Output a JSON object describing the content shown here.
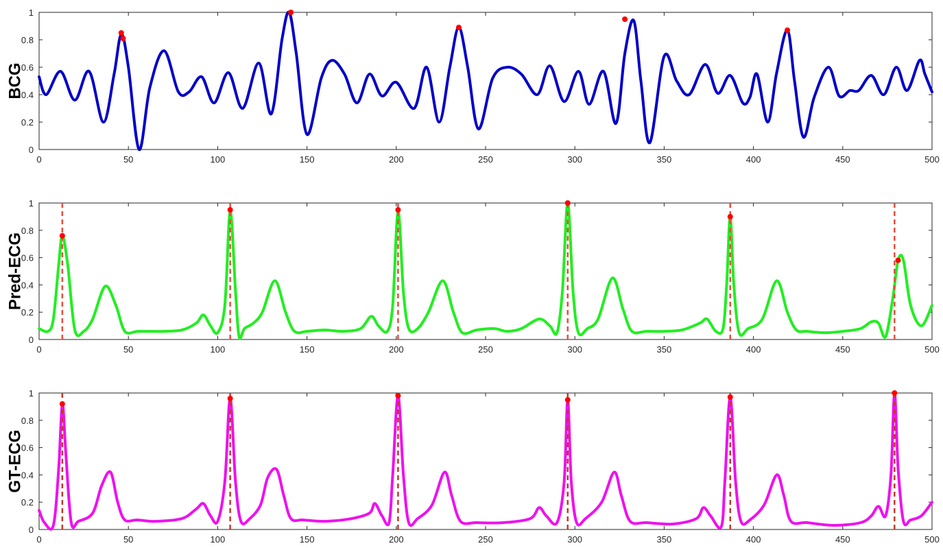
{
  "chart_data": [
    {
      "type": "line",
      "ylabel": "BCG",
      "xlim": [
        0,
        500
      ],
      "ylim": [
        0,
        1
      ],
      "xticks": [
        0,
        50,
        100,
        150,
        200,
        250,
        300,
        350,
        400,
        450,
        500
      ],
      "yticks": [
        0,
        0.2,
        0.4,
        0.6,
        0.8,
        1
      ],
      "xtick_labels": [
        "0",
        "50",
        "100",
        "150",
        "200",
        "250",
        "300",
        "350",
        "400",
        "450",
        "500"
      ],
      "ytick_labels": [
        "0",
        "0.2",
        "0.4",
        "0.6",
        "0.8",
        "1"
      ],
      "grid": false,
      "series": [
        {
          "color": "#0000c8",
          "x": [
            0,
            4,
            12,
            20,
            28,
            36,
            42,
            46,
            50,
            56,
            62,
            70,
            78,
            84,
            91,
            98,
            106,
            114,
            123,
            130,
            136,
            140,
            144,
            150,
            158,
            164,
            171,
            178,
            185,
            192,
            200,
            210,
            217,
            224,
            230,
            235,
            240,
            246,
            254,
            262,
            270,
            279,
            286,
            294,
            302,
            308,
            316,
            323,
            328,
            333,
            337,
            342,
            350,
            357,
            364,
            373,
            380,
            387,
            394,
            398,
            402,
            408,
            413,
            419,
            423,
            428,
            434,
            442,
            448,
            454,
            459,
            466,
            473,
            480,
            486,
            493,
            496,
            500
          ],
          "values": [
            0.53,
            0.4,
            0.57,
            0.36,
            0.57,
            0.2,
            0.55,
            0.84,
            0.6,
            0.0,
            0.45,
            0.72,
            0.42,
            0.42,
            0.53,
            0.34,
            0.56,
            0.3,
            0.63,
            0.26,
            0.8,
            1.0,
            0.7,
            0.11,
            0.52,
            0.65,
            0.55,
            0.34,
            0.55,
            0.39,
            0.49,
            0.3,
            0.6,
            0.2,
            0.6,
            0.89,
            0.6,
            0.15,
            0.52,
            0.6,
            0.55,
            0.4,
            0.61,
            0.35,
            0.57,
            0.33,
            0.57,
            0.19,
            0.7,
            0.94,
            0.5,
            0.05,
            0.68,
            0.5,
            0.4,
            0.62,
            0.41,
            0.54,
            0.34,
            0.38,
            0.55,
            0.2,
            0.56,
            0.87,
            0.5,
            0.09,
            0.38,
            0.6,
            0.39,
            0.43,
            0.43,
            0.54,
            0.4,
            0.6,
            0.43,
            0.65,
            0.55,
            0.42
          ]
        }
      ],
      "peaks": {
        "color": "#ff0000",
        "x": [
          46,
          47,
          141,
          235,
          328,
          419
        ],
        "values": [
          0.85,
          0.81,
          1.0,
          0.89,
          0.95,
          0.87
        ]
      },
      "vlines": []
    },
    {
      "type": "line",
      "ylabel": "Pred-ECG",
      "xlim": [
        0,
        500
      ],
      "ylim": [
        0,
        1
      ],
      "xticks": [
        0,
        50,
        100,
        150,
        200,
        250,
        300,
        350,
        400,
        450,
        500
      ],
      "yticks": [
        0,
        0.2,
        0.4,
        0.6,
        0.8,
        1
      ],
      "xtick_labels": [
        "0",
        "50",
        "100",
        "150",
        "200",
        "250",
        "300",
        "350",
        "400",
        "450",
        "500"
      ],
      "ytick_labels": [
        "0",
        "0.2",
        "0.4",
        "0.6",
        "0.8",
        "1"
      ],
      "grid": false,
      "series": [
        {
          "color": "#22ee22",
          "x": [
            0,
            5,
            8,
            11,
            13,
            16,
            20,
            25,
            30,
            37,
            43,
            48,
            55,
            62,
            70,
            80,
            88,
            92,
            96,
            100,
            104,
            107,
            110,
            112,
            115,
            120,
            125,
            132,
            138,
            143,
            150,
            160,
            170,
            180,
            186,
            190,
            195,
            198,
            201,
            204,
            207,
            212,
            218,
            226,
            232,
            237,
            245,
            255,
            262,
            270,
            280,
            286,
            290,
            293,
            296,
            299,
            302,
            307,
            313,
            321,
            327,
            332,
            340,
            350,
            360,
            370,
            374,
            379,
            383,
            385,
            387,
            389,
            392,
            397,
            405,
            413,
            419,
            424,
            430,
            440,
            450,
            460,
            466,
            470,
            474,
            478,
            481,
            484,
            488,
            494,
            500
          ],
          "values": [
            0.08,
            0.06,
            0.15,
            0.55,
            0.76,
            0.55,
            0.07,
            0.06,
            0.15,
            0.39,
            0.25,
            0.06,
            0.06,
            0.06,
            0.06,
            0.07,
            0.12,
            0.18,
            0.1,
            0.05,
            0.25,
            0.94,
            0.35,
            0.02,
            0.08,
            0.12,
            0.2,
            0.43,
            0.2,
            0.06,
            0.06,
            0.07,
            0.06,
            0.08,
            0.17,
            0.1,
            0.06,
            0.25,
            0.94,
            0.35,
            0.08,
            0.08,
            0.2,
            0.43,
            0.2,
            0.05,
            0.07,
            0.08,
            0.06,
            0.08,
            0.15,
            0.1,
            0.05,
            0.35,
            1.0,
            0.35,
            0.05,
            0.08,
            0.15,
            0.45,
            0.22,
            0.06,
            0.06,
            0.06,
            0.07,
            0.12,
            0.15,
            0.06,
            0.08,
            0.4,
            0.9,
            0.4,
            0.05,
            0.08,
            0.15,
            0.43,
            0.2,
            0.07,
            0.06,
            0.05,
            0.06,
            0.08,
            0.13,
            0.12,
            0.02,
            0.3,
            0.58,
            0.58,
            0.25,
            0.1,
            0.25
          ]
        }
      ],
      "peaks": {
        "color": "#ff0000",
        "x": [
          13,
          107,
          201,
          296,
          387,
          481
        ],
        "values": [
          0.76,
          0.95,
          0.95,
          1.0,
          0.9,
          0.58
        ]
      },
      "vlines": {
        "color": "#e74c3c",
        "x": [
          13,
          107,
          201,
          296,
          387,
          479
        ]
      }
    },
    {
      "type": "line",
      "ylabel": "GT-ECG",
      "xlim": [
        0,
        500
      ],
      "ylim": [
        0,
        1
      ],
      "xticks": [
        0,
        50,
        100,
        150,
        200,
        250,
        300,
        350,
        400,
        450,
        500
      ],
      "yticks": [
        0,
        0.2,
        0.4,
        0.6,
        0.8,
        1
      ],
      "xtick_labels": [
        "0",
        "50",
        "100",
        "150",
        "200",
        "250",
        "300",
        "350",
        "400",
        "450",
        "500"
      ],
      "ytick_labels": [
        "0",
        "0.2",
        "0.4",
        "0.6",
        "0.8",
        "1"
      ],
      "grid": false,
      "series": [
        {
          "color": "#ee11ee",
          "x": [
            0,
            3,
            8,
            11,
            13,
            15,
            18,
            22,
            30,
            35,
            40,
            44,
            48,
            55,
            65,
            80,
            88,
            92,
            96,
            100,
            104,
            107,
            110,
            113,
            118,
            124,
            128,
            133,
            137,
            141,
            148,
            160,
            175,
            185,
            188,
            192,
            196,
            198,
            201,
            204,
            207,
            212,
            220,
            227,
            231,
            236,
            245,
            260,
            275,
            280,
            284,
            290,
            294,
            296,
            298,
            301,
            306,
            315,
            322,
            326,
            331,
            340,
            355,
            368,
            372,
            376,
            382,
            384,
            387,
            390,
            393,
            398,
            406,
            413,
            417,
            421,
            430,
            445,
            460,
            466,
            470,
            474,
            477,
            479,
            481,
            484,
            488,
            494,
            500
          ],
          "values": [
            0.14,
            0.05,
            0.03,
            0.45,
            0.92,
            0.55,
            0.05,
            0.06,
            0.12,
            0.32,
            0.42,
            0.2,
            0.07,
            0.07,
            0.06,
            0.08,
            0.15,
            0.19,
            0.1,
            0.06,
            0.35,
            0.96,
            0.35,
            0.06,
            0.08,
            0.18,
            0.38,
            0.44,
            0.25,
            0.08,
            0.07,
            0.06,
            0.08,
            0.12,
            0.19,
            0.1,
            0.05,
            0.4,
            0.98,
            0.4,
            0.05,
            0.08,
            0.18,
            0.42,
            0.25,
            0.06,
            0.05,
            0.05,
            0.08,
            0.16,
            0.1,
            0.05,
            0.35,
            0.95,
            0.35,
            0.05,
            0.08,
            0.2,
            0.42,
            0.25,
            0.06,
            0.05,
            0.04,
            0.08,
            0.16,
            0.1,
            0.02,
            0.35,
            0.97,
            0.35,
            0.06,
            0.07,
            0.18,
            0.4,
            0.25,
            0.06,
            0.05,
            0.03,
            0.05,
            0.1,
            0.17,
            0.1,
            0.4,
            1.0,
            0.45,
            0.06,
            0.07,
            0.1,
            0.2
          ]
        }
      ],
      "peaks": {
        "color": "#ff0000",
        "x": [
          13,
          107,
          201,
          296,
          387,
          479
        ],
        "values": [
          0.92,
          0.96,
          0.98,
          0.95,
          0.97,
          1.0
        ]
      },
      "vlines": {
        "color": "#c0392b",
        "x": [
          13,
          107,
          201,
          296,
          387,
          479
        ]
      }
    }
  ]
}
